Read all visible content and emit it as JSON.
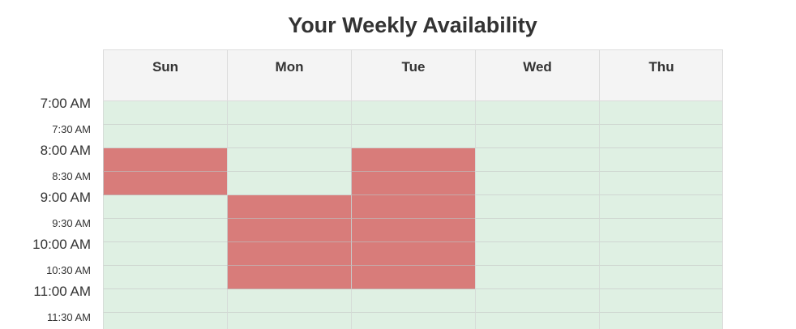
{
  "page": {
    "title": "Your Weekly Availability"
  },
  "days": [
    "Sun",
    "Mon",
    "Tue",
    "Wed",
    "Thu"
  ],
  "time_slots": [
    {
      "label": "7:00 AM",
      "kind": "hour"
    },
    {
      "label": "7:30 AM",
      "kind": "half"
    },
    {
      "label": "8:00 AM",
      "kind": "hour"
    },
    {
      "label": "8:30 AM",
      "kind": "half"
    },
    {
      "label": "9:00 AM",
      "kind": "hour"
    },
    {
      "label": "9:30 AM",
      "kind": "half"
    },
    {
      "label": "10:00 AM",
      "kind": "hour"
    },
    {
      "label": "10:30 AM",
      "kind": "half"
    },
    {
      "label": "11:00 AM",
      "kind": "hour"
    },
    {
      "label": "11:30 AM",
      "kind": "half"
    }
  ],
  "availability": {
    "Sun": [
      "free",
      "free",
      "busy",
      "busy",
      "free",
      "free",
      "free",
      "free",
      "free",
      "free"
    ],
    "Mon": [
      "free",
      "free",
      "free",
      "free",
      "busy",
      "busy",
      "busy",
      "busy",
      "free",
      "free"
    ],
    "Tue": [
      "free",
      "free",
      "busy",
      "busy",
      "busy",
      "busy",
      "busy",
      "busy",
      "free",
      "free"
    ],
    "Wed": [
      "free",
      "free",
      "free",
      "free",
      "free",
      "free",
      "free",
      "free",
      "free",
      "free"
    ],
    "Thu": [
      "free",
      "free",
      "free",
      "free",
      "free",
      "free",
      "free",
      "free",
      "free",
      "free"
    ]
  },
  "colors": {
    "free": "#dff0e3",
    "busy": "#d87c7a",
    "header_bg": "#f4f4f4"
  }
}
